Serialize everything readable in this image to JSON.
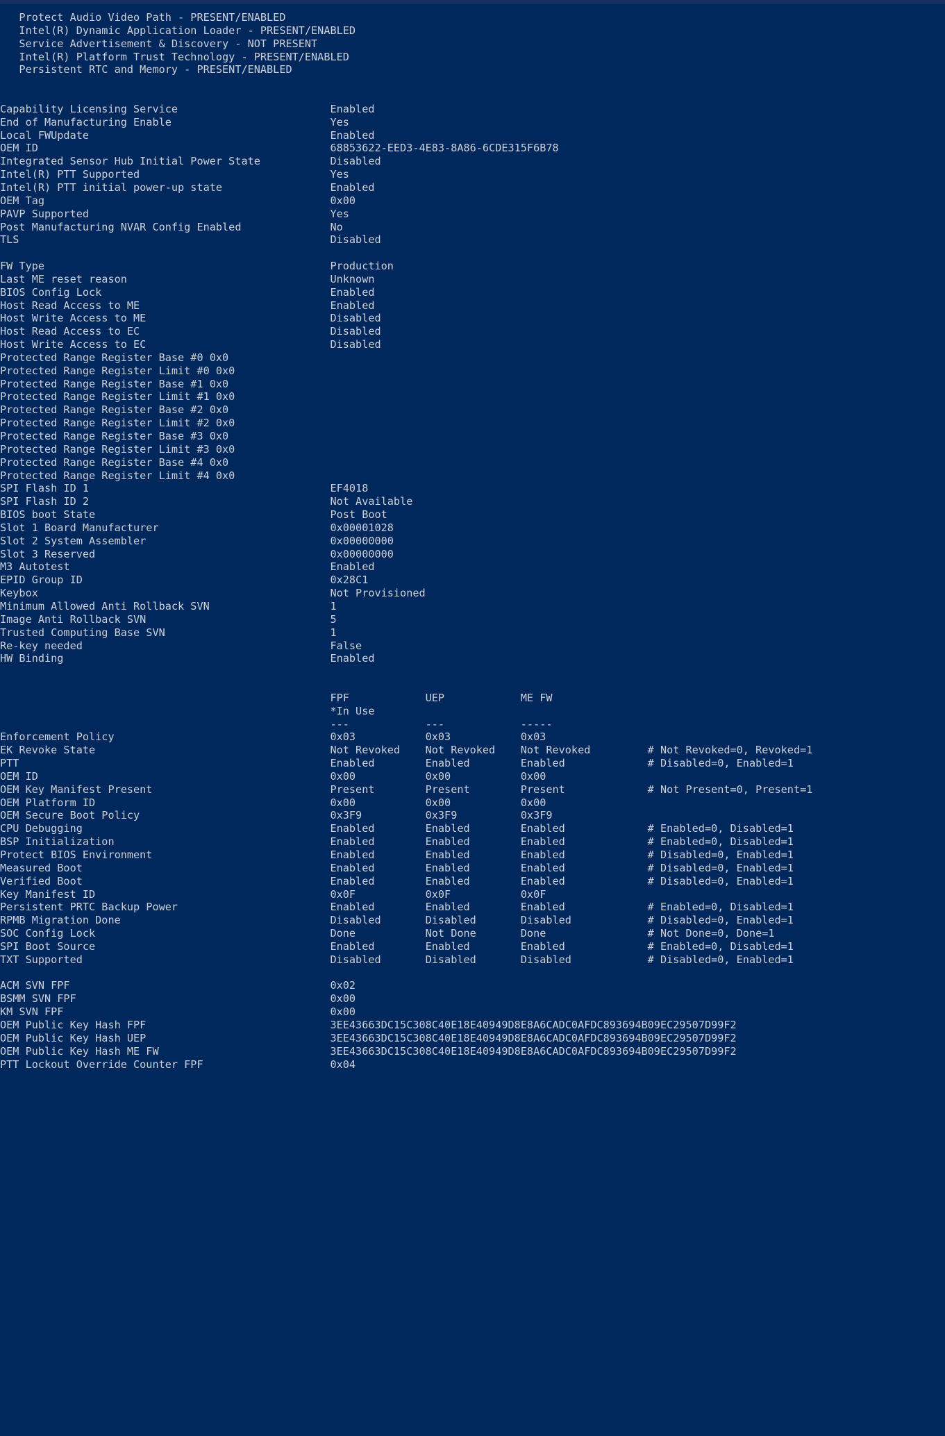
{
  "terminal": {
    "background_color": "#01285c",
    "text_color": "#ccd0d9",
    "titlebar_color": "#17305e",
    "indent_block": [
      "   Protect Audio Video Path - PRESENT/ENABLED",
      "   Intel(R) Dynamic Application Loader - PRESENT/ENABLED",
      "   Service Advertisement & Discovery - NOT PRESENT",
      "   Intel(R) Platform Trust Technology - PRESENT/ENABLED",
      "   Persistent RTC and Memory - PRESENT/ENABLED"
    ],
    "general_section": [
      {
        "label": "Capability Licensing Service",
        "value": "Enabled"
      },
      {
        "label": "End of Manufacturing Enable",
        "value": "Yes"
      },
      {
        "label": "Local FWUpdate",
        "value": "Enabled"
      },
      {
        "label": "OEM ID",
        "value": "68853622-EED3-4E83-8A86-6CDE315F6B78"
      },
      {
        "label": "Integrated Sensor Hub Initial Power State",
        "value": "Disabled"
      },
      {
        "label": "Intel(R) PTT Supported",
        "value": "Yes"
      },
      {
        "label": "Intel(R) PTT initial power-up state",
        "value": "Enabled"
      },
      {
        "label": "OEM Tag",
        "value": "0x00"
      },
      {
        "label": "PAVP Supported",
        "value": "Yes"
      },
      {
        "label": "Post Manufacturing NVAR Config Enabled",
        "value": "No"
      },
      {
        "label": "TLS",
        "value": "Disabled"
      }
    ],
    "fw_section": [
      {
        "label": "FW Type",
        "value": "Production"
      },
      {
        "label": "Last ME reset reason",
        "value": "Unknown"
      },
      {
        "label": "BIOS Config Lock",
        "value": "Enabled"
      },
      {
        "label": "Host Read Access to ME",
        "value": "Enabled"
      },
      {
        "label": "Host Write Access to ME",
        "value": "Disabled"
      },
      {
        "label": "Host Read Access to EC",
        "value": "Disabled"
      },
      {
        "label": "Host Write Access to EC",
        "value": "Disabled"
      }
    ],
    "prr_section": [
      "Protected Range Register Base #0 0x0",
      "Protected Range Register Limit #0 0x0",
      "Protected Range Register Base #1 0x0",
      "Protected Range Register Limit #1 0x0",
      "Protected Range Register Base #2 0x0",
      "Protected Range Register Limit #2 0x0",
      "Protected Range Register Base #3 0x0",
      "Protected Range Register Limit #3 0x0",
      "Protected Range Register Base #4 0x0",
      "Protected Range Register Limit #4 0x0"
    ],
    "spi_section": [
      {
        "label": "SPI Flash ID 1",
        "value": "EF4018"
      },
      {
        "label": "SPI Flash ID 2",
        "value": "Not Available"
      },
      {
        "label": "BIOS boot State",
        "value": "Post Boot"
      },
      {
        "label": "Slot 1 Board Manufacturer",
        "value": "0x00001028"
      },
      {
        "label": "Slot 2 System Assembler",
        "value": "0x00000000"
      },
      {
        "label": "Slot 3 Reserved",
        "value": "0x00000000"
      },
      {
        "label": "M3 Autotest",
        "value": "Enabled"
      },
      {
        "label": "EPID Group ID",
        "value": "0x28C1"
      },
      {
        "label": "Keybox",
        "value": "Not Provisioned"
      },
      {
        "label": "Minimum Allowed Anti Rollback SVN",
        "value": "1"
      },
      {
        "label": "Image Anti Rollback SVN",
        "value": "5"
      },
      {
        "label": "Trusted Computing Base SVN",
        "value": "1"
      },
      {
        "label": "Re-key needed",
        "value": "False"
      },
      {
        "label": "HW Binding",
        "value": "Enabled"
      }
    ],
    "fpf_table": {
      "headers": {
        "col1": "FPF",
        "col2": "UEP",
        "col3": "ME FW"
      },
      "subheader": "*In Use",
      "rules": {
        "col1": "---",
        "col2": "---",
        "col3": "-----"
      },
      "rows": [
        {
          "label": "Enforcement Policy",
          "fpf": "0x03",
          "uep": "0x03",
          "mefw": "0x03",
          "comment": ""
        },
        {
          "label": "EK Revoke State",
          "fpf": "Not Revoked",
          "uep": "Not Revoked",
          "mefw": "Not Revoked",
          "comment": "# Not Revoked=0, Revoked=1"
        },
        {
          "label": "PTT",
          "fpf": "Enabled",
          "uep": "Enabled",
          "mefw": "Enabled",
          "comment": "# Disabled=0, Enabled=1"
        },
        {
          "label": "OEM ID",
          "fpf": "0x00",
          "uep": "0x00",
          "mefw": "0x00",
          "comment": ""
        },
        {
          "label": "OEM Key Manifest Present",
          "fpf": "Present",
          "uep": "Present",
          "mefw": "Present",
          "comment": "# Not Present=0, Present=1"
        },
        {
          "label": "OEM Platform ID",
          "fpf": "0x00",
          "uep": "0x00",
          "mefw": "0x00",
          "comment": ""
        },
        {
          "label": "OEM Secure Boot Policy",
          "fpf": "0x3F9",
          "uep": "0x3F9",
          "mefw": "0x3F9",
          "comment": ""
        },
        {
          "label": "CPU Debugging",
          "fpf": "Enabled",
          "uep": "Enabled",
          "mefw": "Enabled",
          "comment": "# Enabled=0, Disabled=1"
        },
        {
          "label": "BSP Initialization",
          "fpf": "Enabled",
          "uep": "Enabled",
          "mefw": "Enabled",
          "comment": "# Enabled=0, Disabled=1"
        },
        {
          "label": "Protect BIOS Environment",
          "fpf": "Enabled",
          "uep": "Enabled",
          "mefw": "Enabled",
          "comment": "# Disabled=0, Enabled=1"
        },
        {
          "label": "Measured Boot",
          "fpf": "Enabled",
          "uep": "Enabled",
          "mefw": "Enabled",
          "comment": "# Disabled=0, Enabled=1"
        },
        {
          "label": "Verified Boot",
          "fpf": "Enabled",
          "uep": "Enabled",
          "mefw": "Enabled",
          "comment": "# Disabled=0, Enabled=1"
        },
        {
          "label": "Key Manifest ID",
          "fpf": "0x0F",
          "uep": "0x0F",
          "mefw": "0x0F",
          "comment": ""
        },
        {
          "label": "Persistent PRTC Backup Power",
          "fpf": "Enabled",
          "uep": "Enabled",
          "mefw": "Enabled",
          "comment": "# Enabled=0, Disabled=1"
        },
        {
          "label": "RPMB Migration Done",
          "fpf": "Disabled",
          "uep": "Disabled",
          "mefw": "Disabled",
          "comment": "# Disabled=0, Enabled=1"
        },
        {
          "label": "SOC Config Lock",
          "fpf": "Done",
          "uep": "Not Done",
          "mefw": "Done",
          "comment": "# Not Done=0, Done=1"
        },
        {
          "label": "SPI Boot Source",
          "fpf": "Enabled",
          "uep": "Enabled",
          "mefw": "Enabled",
          "comment": "# Enabled=0, Disabled=1"
        },
        {
          "label": "TXT Supported",
          "fpf": "Disabled",
          "uep": "Disabled",
          "mefw": "Disabled",
          "comment": "# Disabled=0, Enabled=1"
        }
      ]
    },
    "svn_section": [
      {
        "label": "ACM SVN FPF",
        "value": "0x02"
      },
      {
        "label": "BSMM SVN FPF",
        "value": "0x00"
      },
      {
        "label": "KM SVN FPF",
        "value": "0x00"
      },
      {
        "label": "OEM Public Key Hash FPF",
        "value": "3EE43663DC15C308C40E18E40949D8E8A6CADC0AFDC893694B09EC29507D99F2"
      },
      {
        "label": "OEM Public Key Hash UEP",
        "value": "3EE43663DC15C308C40E18E40949D8E8A6CADC0AFDC893694B09EC29507D99F2"
      },
      {
        "label": "OEM Public Key Hash ME FW",
        "value": "3EE43663DC15C308C40E18E40949D8E8A6CADC0AFDC893694B09EC29507D99F2"
      },
      {
        "label": "PTT Lockout Override Counter FPF",
        "value": "0x04"
      }
    ]
  }
}
